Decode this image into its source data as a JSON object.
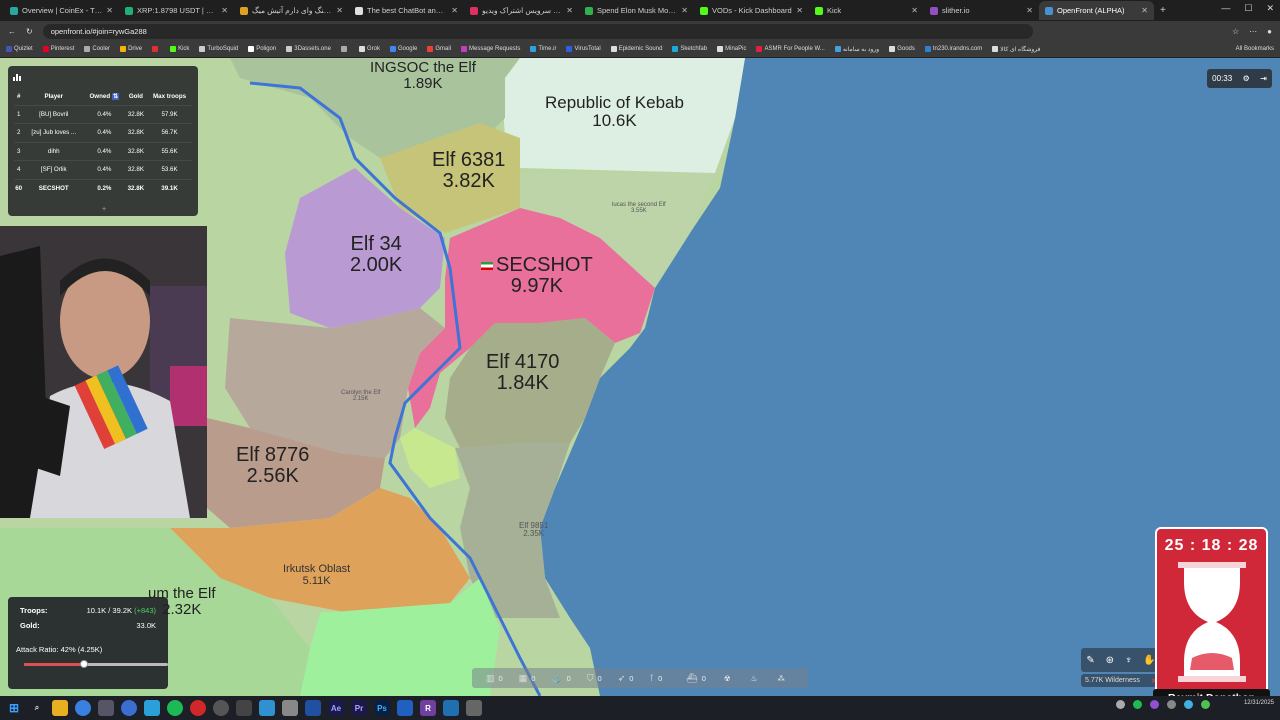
{
  "browser": {
    "tabs": [
      {
        "label": "Overview | CoinEx - The Glob",
        "color": "#2aa8a0",
        "active": false
      },
      {
        "label": "XRP:1.8798 USDT | Futures M",
        "color": "#1fb078",
        "active": false
      },
      {
        "label": "دانلود آهنگ وای دارم آتیش میگ",
        "color": "#e0a020",
        "active": false
      },
      {
        "label": "The best ChatBot and Widget",
        "color": "#e0e0e0",
        "active": false
      },
      {
        "label": "آپارات - سرویس اشتراک ویدیو",
        "color": "#e03060",
        "active": false
      },
      {
        "label": "Spend Elon Musk Money",
        "color": "#30b050",
        "active": false
      },
      {
        "label": "VODs - Kick Dashboard",
        "color": "#53fc18",
        "active": false
      },
      {
        "label": "Kick",
        "color": "#53fc18",
        "active": false
      },
      {
        "label": "slither.io",
        "color": "#9050c0",
        "active": false
      },
      {
        "label": "OpenFront (ALPHA)",
        "color": "#4a90d0",
        "active": true
      }
    ],
    "url": "openfront.io/#join=rywGa288",
    "bookmarks": [
      {
        "label": "Quizlet",
        "color": "#4257b2"
      },
      {
        "label": "Pinterest",
        "color": "#e60023"
      },
      {
        "label": "Cooler",
        "color": "#aaaaaa"
      },
      {
        "label": "Drive",
        "color": "#f4b400"
      },
      {
        "label": "",
        "color": "#e03030"
      },
      {
        "label": "Kick",
        "color": "#53fc18"
      },
      {
        "label": "TurboSquid",
        "color": "#cccccc"
      },
      {
        "label": "Poligon",
        "color": "#ffffff"
      },
      {
        "label": "3Dassets.one",
        "color": "#cccccc"
      },
      {
        "label": "",
        "color": "#aaaaaa"
      },
      {
        "label": "Grok",
        "color": "#dddddd"
      },
      {
        "label": "Google",
        "color": "#4285f4"
      },
      {
        "label": "Gmail",
        "color": "#ea4335"
      },
      {
        "label": "Message Requests",
        "color": "#c040c0"
      },
      {
        "label": "Time.ir",
        "color": "#30a0e0"
      },
      {
        "label": "VirusTotal",
        "color": "#3060e0"
      },
      {
        "label": "Epidemic Sound",
        "color": "#dddddd"
      },
      {
        "label": "Sketchfab",
        "color": "#1caad9"
      },
      {
        "label": "MinaPic",
        "color": "#dddddd"
      },
      {
        "label": "ASMR For People W...",
        "color": "#e02040"
      },
      {
        "label": "ورود به سامانه",
        "color": "#40a0e0"
      },
      {
        "label": "Goods",
        "color": "#dddddd"
      },
      {
        "label": "tn230.irandns.com",
        "color": "#3080d0"
      },
      {
        "label": "فروشگاه ای کالا",
        "color": "#dddddd"
      }
    ],
    "all_bookmarks": "All Bookmarks"
  },
  "map": {
    "labels": [
      {
        "name": "INGSOC the Elf",
        "value": "1.89K"
      },
      {
        "name": "Republic of Kebab",
        "value": "10.6K"
      },
      {
        "name": "Elf 6381",
        "value": "3.82K"
      },
      {
        "name": "lucas the second Elf",
        "value": "3.55K"
      },
      {
        "name": "Elf 34",
        "value": "2.00K"
      },
      {
        "name": "SECSHOT",
        "value": "9.97K"
      },
      {
        "name": "Elf 4170",
        "value": "1.84K"
      },
      {
        "name": "Carolyn the Elf",
        "value": "2.15K"
      },
      {
        "name": "Elf 8776",
        "value": "2.56K"
      },
      {
        "name": "Elf 9851",
        "value": "2.35K"
      },
      {
        "name": "Irkutsk Oblast",
        "value": "5.11K"
      },
      {
        "name": "um the Elf",
        "value": "2.32K"
      }
    ]
  },
  "leaderboard": {
    "headers": [
      "#",
      "Player",
      "Owned",
      "Gold",
      "Max troops"
    ],
    "rows": [
      {
        "rank": "1",
        "player": "[BU] Bovril",
        "owned": "0.4%",
        "gold": "32.8K",
        "troops": "57.9K",
        "me": false
      },
      {
        "rank": "2",
        "player": "[zu] Jub loves ...",
        "owned": "0.4%",
        "gold": "32.8K",
        "troops": "56.7K",
        "me": false
      },
      {
        "rank": "3",
        "player": "dihh",
        "owned": "0.4%",
        "gold": "32.8K",
        "troops": "55.6K",
        "me": false
      },
      {
        "rank": "4",
        "player": "[SF] Orlik",
        "owned": "0.4%",
        "gold": "32.8K",
        "troops": "53.6K",
        "me": false
      },
      {
        "rank": "60",
        "player": "SECSHOT",
        "owned": "0.2%",
        "gold": "32.8K",
        "troops": "39.1K",
        "me": true
      }
    ],
    "expand": "+"
  },
  "stats": {
    "troops_label": "Troops:",
    "troops_value": "10.1K / 39.2K",
    "troops_delta": "(+843)",
    "gold_label": "Gold:",
    "gold_value": "33.0K",
    "attack_label": "Attack Ratio: 42% (4.25K)",
    "attack_ratio": 0.42
  },
  "bottombar": {
    "counts": [
      "0",
      "0",
      "0",
      "0",
      "0",
      "0",
      "0"
    ]
  },
  "game_timer": "00:33",
  "wilderness": "5.77K Wilderness",
  "stream_timer": {
    "time": "25 : 18 : 28",
    "caption": "Reymit Donathon"
  },
  "clock": {
    "time": "",
    "date": "12/31/2025"
  }
}
